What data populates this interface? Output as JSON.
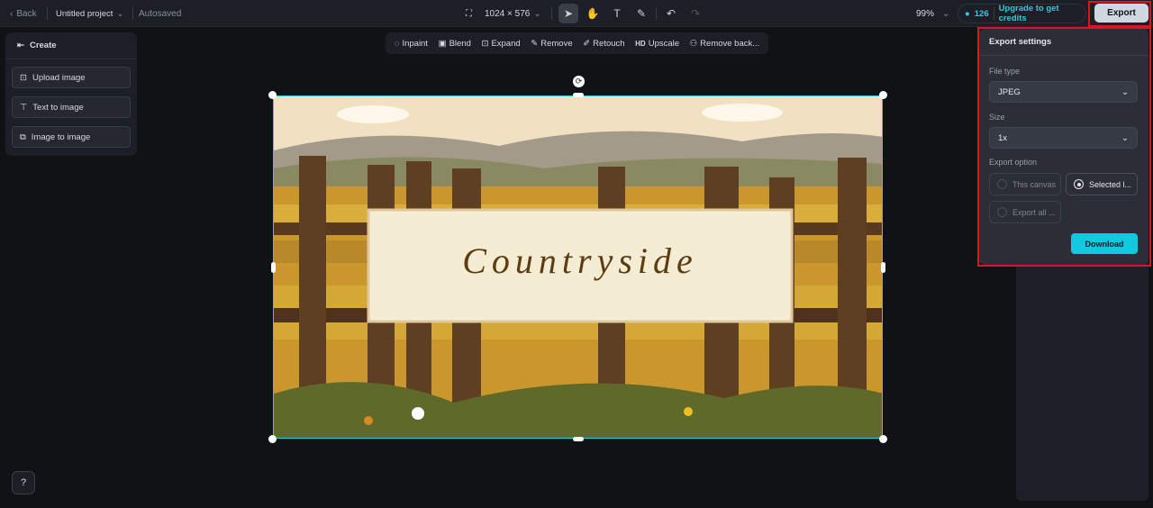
{
  "topbar": {
    "back": "Back",
    "project": "Untitled project",
    "autosaved": "Autosaved",
    "dimensions": "1024 × 576",
    "zoom": "99%",
    "credits": "126",
    "upgrade": "Upgrade to get credits",
    "export": "Export"
  },
  "tools": [
    "select-icon",
    "hand-icon",
    "text-icon",
    "brush-icon",
    "undo-icon",
    "redo-icon"
  ],
  "left_panel": {
    "title": "Create",
    "items": [
      {
        "label": "Upload image",
        "icon": "upload-image-icon"
      },
      {
        "label": "Text to image",
        "icon": "text-to-image-icon"
      },
      {
        "label": "Image to image",
        "icon": "image-to-image-icon"
      }
    ]
  },
  "float_toolbar": [
    {
      "label": "Inpaint",
      "icon": "◌"
    },
    {
      "label": "Blend",
      "icon": "▣"
    },
    {
      "label": "Expand",
      "icon": "⊡"
    },
    {
      "label": "Remove",
      "icon": "✎"
    },
    {
      "label": "Retouch",
      "icon": "✐"
    },
    {
      "label": "Upscale",
      "icon": "HD"
    },
    {
      "label": "Remove back...",
      "icon": "⚇"
    }
  ],
  "canvas": {
    "image_text": "Countryside"
  },
  "export_settings": {
    "title": "Export settings",
    "file_type_label": "File type",
    "file_type": "JPEG",
    "size_label": "Size",
    "size": "1x",
    "option_label": "Export option",
    "options": [
      {
        "label": "This canvas",
        "selected": false
      },
      {
        "label": "Selected l...",
        "selected": true
      },
      {
        "label": "Export all ...",
        "selected": false
      }
    ],
    "download": "Download"
  },
  "colors": {
    "accent": "#0fc9de",
    "highlight": "#e0141e"
  }
}
